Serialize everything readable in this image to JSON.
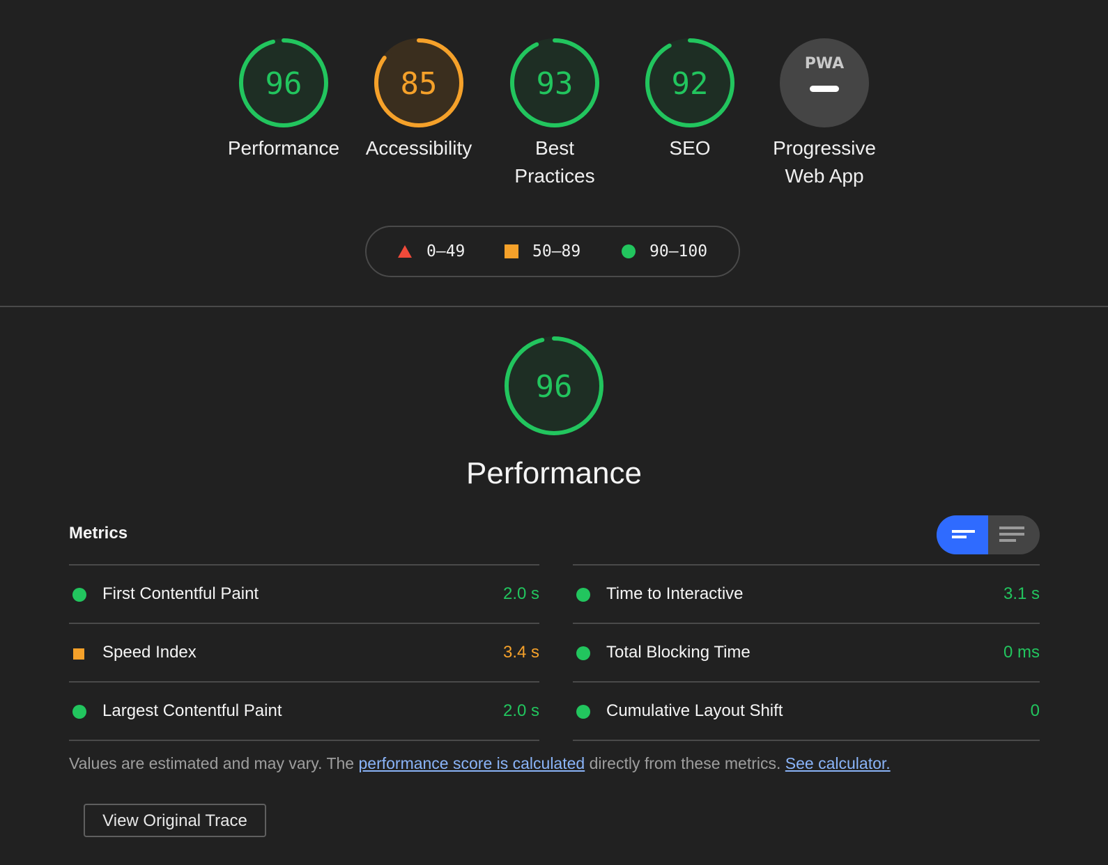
{
  "colors": {
    "pass": "#22c55e",
    "average": "#f5a12a",
    "fail": "#f04a3a",
    "pwa_gray": "#454545",
    "accent": "#2f6bff"
  },
  "categories": [
    {
      "id": "performance",
      "score": "96",
      "score_value": 96,
      "label": "Performance",
      "rating": "pass"
    },
    {
      "id": "accessibility",
      "score": "85",
      "score_value": 85,
      "label": "Accessibility",
      "rating": "average"
    },
    {
      "id": "best-practices",
      "score": "93",
      "score_value": 93,
      "label": "Best Practices",
      "rating": "pass"
    },
    {
      "id": "seo",
      "score": "92",
      "score_value": 92,
      "label": "SEO",
      "rating": "pass"
    },
    {
      "id": "pwa",
      "score": "",
      "label": "Progressive Web App",
      "rating": "na",
      "badge_text": "PWA"
    }
  ],
  "legend": [
    {
      "range": "0–49",
      "icon": "triangle-icon"
    },
    {
      "range": "50–89",
      "icon": "square-icon"
    },
    {
      "range": "90–100",
      "icon": "circle-icon"
    }
  ],
  "performance": {
    "score": "96",
    "score_value": 96,
    "title": "Performance"
  },
  "metrics": {
    "title": "Metrics",
    "left": [
      {
        "name": "First Contentful Paint",
        "value": "2.0 s",
        "rating": "pass"
      },
      {
        "name": "Speed Index",
        "value": "3.4 s",
        "rating": "average"
      },
      {
        "name": "Largest Contentful Paint",
        "value": "2.0 s",
        "rating": "pass"
      }
    ],
    "right": [
      {
        "name": "Time to Interactive",
        "value": "3.1 s",
        "rating": "pass"
      },
      {
        "name": "Total Blocking Time",
        "value": "0 ms",
        "rating": "pass"
      },
      {
        "name": "Cumulative Layout Shift",
        "value": "0",
        "rating": "pass"
      }
    ]
  },
  "note": {
    "prefix": "Values are estimated and may vary. The ",
    "link1": "performance score is calculated",
    "middle": " directly from these metrics. ",
    "link2": "See calculator."
  },
  "trace_button": "View Original Trace"
}
